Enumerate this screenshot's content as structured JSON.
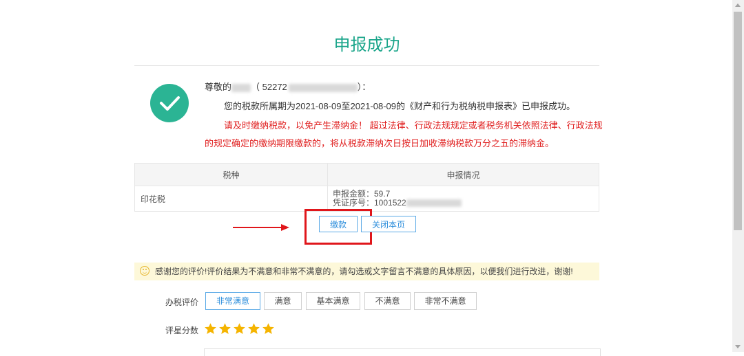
{
  "page": {
    "title": "申报成功"
  },
  "message": {
    "greeting_prefix": "尊敬的",
    "greeting_open": "（ 52272",
    "greeting_close": "）：",
    "info_text": "您的税款所属期为2021-08-09至2021-08-09的《财产和行为税纳税申报表》已申报成功。",
    "warning_text": "请及时缴纳税款，以免产生滞纳金！ 超过法律、行政法规规定或者税务机关依照法律、行政法规的规定确定的缴纳期限缴款的，将从税款滞纳次日按日加收滞纳税款万分之五的滞纳金。"
  },
  "table": {
    "headers": [
      "税种",
      "申报情况"
    ],
    "rows": [
      {
        "tax_type": "印花税",
        "amount_line": "申报金额：59.7",
        "voucher_line": "凭证序号：1001522"
      }
    ]
  },
  "actions": {
    "pay_label": "缴款",
    "close_label": "关闭本页"
  },
  "feedback": {
    "notice": "感谢您的评价!评价结果为不满意和非常不满意的，请勾选或文字留言不满意的具体原因，以便我们进行改进，谢谢!",
    "rating_label": "办税评价",
    "options": [
      "非常满意",
      "满意",
      "基本满意",
      "不满意",
      "非常不满意"
    ],
    "selected_option": "非常满意",
    "stars_label": "评星分数",
    "stars_count": 5
  },
  "colors": {
    "title_green": "#1aa58a",
    "success_green": "#2bb494",
    "warning_red": "#e02020",
    "highlight_red": "#e0161b",
    "button_blue": "#2b8ddb",
    "star_gold": "#f5b400",
    "notice_bg": "#fdf8d9"
  }
}
